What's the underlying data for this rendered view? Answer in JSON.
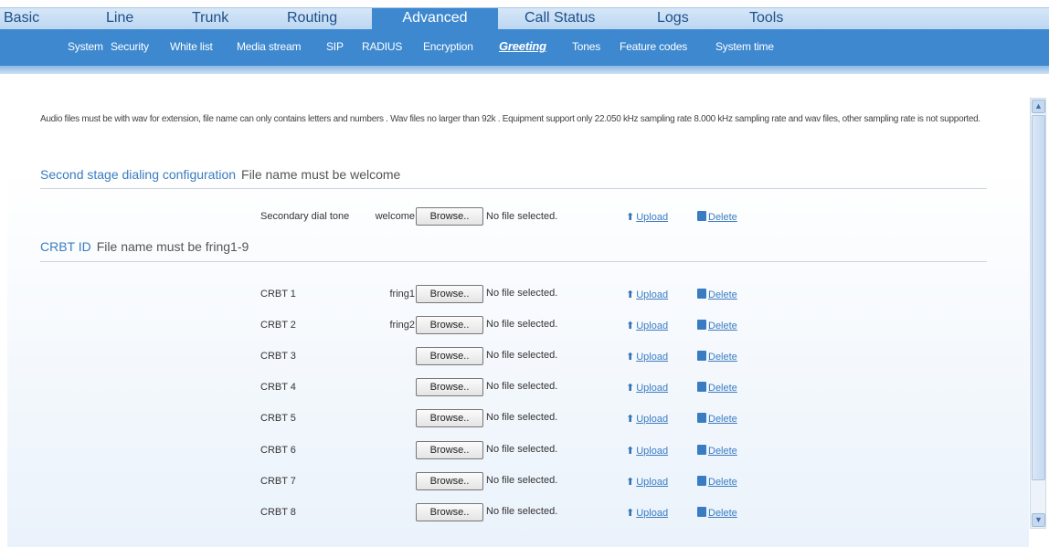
{
  "top_nav": {
    "tabs": [
      "Basic",
      "Line",
      "Trunk",
      "Routing",
      "Advanced",
      "Call Status",
      "Logs",
      "Tools"
    ],
    "active": "Advanced"
  },
  "sub_nav": {
    "items": [
      "System",
      "Security",
      "White list",
      "Media stream",
      "SIP",
      "RADIUS",
      "Encryption",
      "Greeting",
      "Tones",
      "Feature codes",
      "System time"
    ],
    "active": "Greeting"
  },
  "note": "Audio files must be with wav for extension, file name can only contains letters and numbers . Wav files no larger than 92k . Equipment support only 22.050 kHz sampling rate 8.000 kHz sampling rate and wav files, other sampling rate is not supported.",
  "second_stage": {
    "title": "Second stage dialing configuration",
    "hint": "File name must be welcome",
    "row": {
      "label": "Secondary dial tone",
      "filename": "welcome",
      "browse": "Browse..",
      "status": "No file selected.",
      "upload": "Upload",
      "delete": "Delete"
    }
  },
  "crbt": {
    "title": "CRBT ID",
    "hint": "File name must be fring1-9",
    "rows": [
      {
        "label": "CRBT 1",
        "filename": "fring1",
        "browse": "Browse..",
        "status": "No file selected.",
        "upload": "Upload",
        "delete": "Delete"
      },
      {
        "label": "CRBT 2",
        "filename": "fring2",
        "browse": "Browse..",
        "status": "No file selected.",
        "upload": "Upload",
        "delete": "Delete"
      },
      {
        "label": "CRBT 3",
        "filename": "",
        "browse": "Browse..",
        "status": "No file selected.",
        "upload": "Upload",
        "delete": "Delete"
      },
      {
        "label": "CRBT 4",
        "filename": "",
        "browse": "Browse..",
        "status": "No file selected.",
        "upload": "Upload",
        "delete": "Delete"
      },
      {
        "label": "CRBT 5",
        "filename": "",
        "browse": "Browse..",
        "status": "No file selected.",
        "upload": "Upload",
        "delete": "Delete"
      },
      {
        "label": "CRBT 6",
        "filename": "",
        "browse": "Browse..",
        "status": "No file selected.",
        "upload": "Upload",
        "delete": "Delete"
      },
      {
        "label": "CRBT 7",
        "filename": "",
        "browse": "Browse..",
        "status": "No file selected.",
        "upload": "Upload",
        "delete": "Delete"
      },
      {
        "label": "CRBT 8",
        "filename": "",
        "browse": "Browse..",
        "status": "No file selected.",
        "upload": "Upload",
        "delete": "Delete"
      }
    ]
  },
  "icons": {
    "upload": "upload-arrow-icon",
    "delete": "trash-can-icon",
    "scroll_up": "chevron-up-icon",
    "scroll_down": "chevron-down-icon"
  },
  "colors": {
    "accent": "#3d88cf",
    "link": "#3a7cc2",
    "nav_bg": "#c9dff5"
  }
}
